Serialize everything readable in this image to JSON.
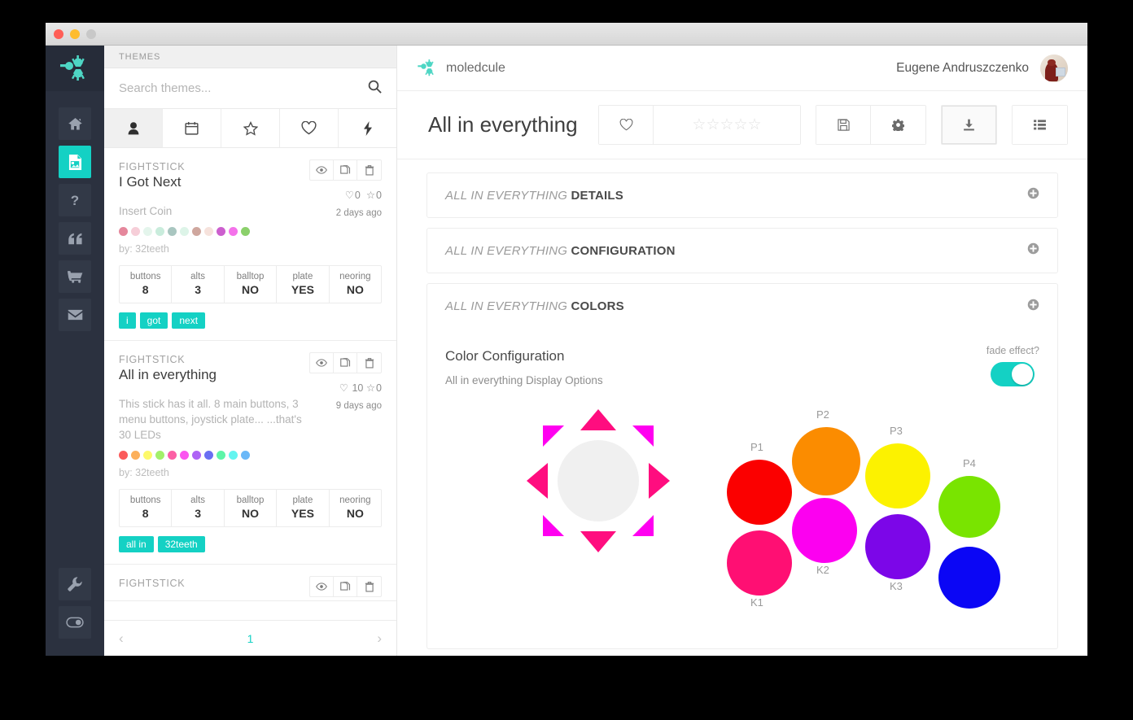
{
  "window": {
    "traffic_lights": [
      "close",
      "minimize",
      "zoom"
    ]
  },
  "brand": {
    "name": "moledcule",
    "logo_icon": "molecule-icon"
  },
  "rail": {
    "items": [
      {
        "name": "home",
        "icon": "home-icon",
        "active": false
      },
      {
        "name": "themes",
        "icon": "image-file-icon",
        "active": true
      },
      {
        "name": "help",
        "icon": "question-icon",
        "active": false
      },
      {
        "name": "quotes",
        "icon": "quote-icon",
        "active": false
      },
      {
        "name": "store",
        "icon": "cart-icon",
        "active": false
      },
      {
        "name": "mail",
        "icon": "envelope-icon",
        "active": false
      }
    ],
    "bottom": [
      {
        "name": "settings",
        "icon": "wrench-icon"
      },
      {
        "name": "power",
        "icon": "toggle-icon"
      }
    ]
  },
  "themes_panel": {
    "header": "THEMES",
    "search": {
      "placeholder": "Search themes...",
      "value": "",
      "icon": "search-icon"
    },
    "filter_tabs": [
      {
        "name": "user",
        "icon": "user-icon",
        "active": true
      },
      {
        "name": "calendar",
        "icon": "calendar-icon",
        "active": false
      },
      {
        "name": "featured",
        "icon": "star-icon",
        "active": false
      },
      {
        "name": "favorites",
        "icon": "heart-icon",
        "active": false
      },
      {
        "name": "trending",
        "icon": "bolt-icon",
        "active": false
      }
    ],
    "card_actions": [
      {
        "name": "preview",
        "icon": "eye-icon"
      },
      {
        "name": "duplicate",
        "icon": "copy-icon"
      },
      {
        "name": "delete",
        "icon": "trash-icon"
      }
    ],
    "spec_labels": [
      "buttons",
      "alts",
      "balltop",
      "plate",
      "neoring"
    ],
    "cards": [
      {
        "kind": "FIGHTSTICK",
        "title": "I Got Next",
        "desc": "Insert Coin",
        "likes": "0",
        "stars": "0",
        "date": "2 days ago",
        "by": "by: 32teeth",
        "swatches": [
          "#e5879c",
          "#f6ced8",
          "#e4f5ec",
          "#c9ecdc",
          "#a9c6c0",
          "#ddf4e8",
          "#cfa79e",
          "#f6e2dc",
          "#cc5fce",
          "#f472ea",
          "#8bd06b"
        ],
        "specs": [
          "8",
          "3",
          "NO",
          "YES",
          "NO"
        ],
        "tags": [
          "i",
          "got",
          "next"
        ]
      },
      {
        "kind": "FIGHTSTICK",
        "title": "All in everything",
        "desc": "This stick has it all. 8 main buttons, 3 menu buttons, joystick plate... ...that's 30 LEDs",
        "likes": "10",
        "stars": "0",
        "date": "9 days ago",
        "by": "by: 32teeth",
        "swatches": [
          "#fb5b5b",
          "#fcb05b",
          "#fdf96a",
          "#a3f06a",
          "#fc5fa5",
          "#fb55f0",
          "#ae63f5",
          "#6a6ff2",
          "#5ef5a8",
          "#63f5f0",
          "#6ab8f8"
        ],
        "specs": [
          "8",
          "3",
          "NO",
          "YES",
          "NO"
        ],
        "tags": [
          "all in",
          "32teeth"
        ]
      },
      {
        "kind": "FIGHTSTICK",
        "title": "",
        "desc": "",
        "likes": "",
        "stars": "",
        "date": "",
        "by": "",
        "swatches": [],
        "specs": [],
        "tags": []
      }
    ],
    "pagination": {
      "prev": "‹",
      "page": "1",
      "next": "›"
    }
  },
  "topbar": {
    "user_name": "Eugene Andruszczenko",
    "avatar_icon": "avatar"
  },
  "content": {
    "title": "All in everything",
    "tools": [
      {
        "name": "favorite",
        "icon": "heart-icon",
        "label": ""
      },
      {
        "name": "rating",
        "icon": "stars-icon",
        "label": "",
        "stars": 5,
        "filled": 0
      },
      {
        "name": "save",
        "icon": "floppy-icon",
        "label": ""
      },
      {
        "name": "settings",
        "icon": "gear-icon",
        "label": ""
      },
      {
        "name": "download",
        "icon": "download-icon",
        "label": "",
        "pressed": true
      },
      {
        "name": "list",
        "icon": "list-icon",
        "label": ""
      }
    ],
    "accordions": [
      {
        "prefix": "ALL IN EVERYTHING",
        "suffix": "DETAILS",
        "expand_icon": "plus-circle-icon"
      },
      {
        "prefix": "ALL IN EVERYTHING",
        "suffix": "CONFIGURATION",
        "expand_icon": "plus-circle-icon"
      },
      {
        "prefix": "ALL IN EVERYTHING",
        "suffix": "COLORS",
        "expand_icon": "plus-circle-icon"
      }
    ],
    "color_config": {
      "title": "Color Configuration",
      "subtitle": "All in everything Display Options",
      "toggle_label": "fade effect?",
      "toggle_on": true,
      "toggle_color": "#14d1c4"
    },
    "diagram": {
      "joystick": {
        "center_color": "#f0f0f0",
        "cardinal_color": "#ff0d7f",
        "diagonal_color": "#ff00f0"
      },
      "buttons": [
        {
          "label": "P1",
          "color": "#fb0000",
          "label_pos": "top"
        },
        {
          "label": "P2",
          "color": "#fb8c00",
          "label_pos": "top"
        },
        {
          "label": "P3",
          "color": "#fcf200",
          "label_pos": "top"
        },
        {
          "label": "P4",
          "color": "#79e400",
          "label_pos": "top"
        },
        {
          "label": "K1",
          "color": "#ff0f73",
          "label_pos": "bottom"
        },
        {
          "label": "K2",
          "color": "#fc00f0",
          "label_pos": "bottom"
        },
        {
          "label": "K3",
          "color": "#7c06e8",
          "label_pos": "bottom"
        },
        {
          "label": "",
          "color": "#0b06f5",
          "label_pos": "none"
        }
      ]
    }
  },
  "colors": {
    "accent": "#14d1c4",
    "rail_bg": "#2b313f",
    "rail_btn": "#323947"
  }
}
